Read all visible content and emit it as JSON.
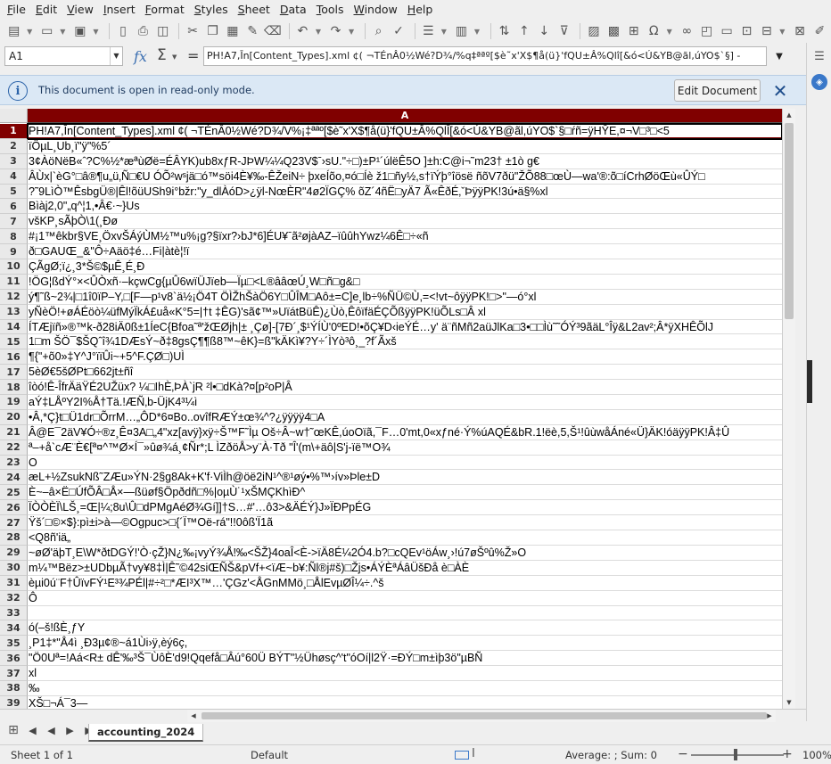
{
  "menu": [
    "File",
    "Edit",
    "View",
    "Insert",
    "Format",
    "Styles",
    "Sheet",
    "Data",
    "Tools",
    "Window",
    "Help"
  ],
  "formula": {
    "name_box": "A1",
    "content": "PH!A7,Īn[Content_Types].xml ¢( ¬TÉnÂ0½Wé?D¾/%q‡ªªº[$è˜x'X$¶å(ü}'fQU±Â%Qlî[&ó<Ú&YB@ãl,úYO$`§] -"
  },
  "infobar": {
    "message": "This document is open in read-only mode.",
    "edit_button": "Edit Document"
  },
  "grid": {
    "column_header": "A",
    "rows": [
      {
        "n": "1",
        "text": "PH!A7,Īn[Content_Types].xml ¢( ¬TÉnÂ0½Wé?D¾/V%¡‡ªªº[$è˜x'X$¶å(ü}'fQU±Â%QlÎ[&ó<Ú&YB@ãl,úYO$`§□ŕñ=ÿHŶE,¤¬V□³□<5"
      },
      {
        "n": "2",
        "text": "ïÖµL¸Ub¸ï\"ÿ\"%5´"
      },
      {
        "n": "3",
        "text": "3¢ÀöNëB«ˆ?C%½*æªùØë=ÉÂYK)ub8xƒR-JÞW¼¼Q23V$ˉ›sU.\"÷□)±P¹´úlëÊ5O ]±h:C@i¬˜m23†      ±1ò g€"
      },
      {
        "n": "4",
        "text": "ÂÙx|`èG°□â®¶u„ü‚Ñ□€U ÓÕ²wˢjä□ó™söi4È¥‰-ÊŽeiN÷   þxeÍõo,¤ó□Íè ž1□ñy½,s†ïÝþ°îösë      ñõV7ðü\"ŽÕ88□œÙ—wa'®:õ□íCrhØöŒù«ÛÝ□"
      },
      {
        "n": "5",
        "text": "?˜9LìÒ™ÊsbgÜ®|Êl!õüUSh9i°bžr:\"y_dlÀóD>¿ÿl-NœÈR\"4ø2ÏGÇ% õZ´4ñË□yÄ7  Ã«ÊðÉ‚ˇÞÿÿPK!3ú•ä§%xl"
      },
      {
        "n": "6",
        "text": "Bìàj2,0\"„q^¦1,•Â€·~}Us"
      },
      {
        "n": "7",
        "text": "všKP¸sÃþÒ\\1(¸Ðø"
      },
      {
        "n": "8",
        "text": "#¡1™êkbr§VE¸ÖxvŠÁýÙM½™u%¡g?§ïxr?›bJ*6]ÉU¥ˉã²øjàAZ–ïûûhYwz¼6Ê□÷«ñ"
      },
      {
        "n": "9",
        "text": "ð□GAUŒ_&\"Ô÷Aäö‡é…Fi|àtè¦!ï"
      },
      {
        "n": "10",
        "text": "ÇÃgØ;ï¿¸3*Š©$µÊ¸É¸Ð"
      },
      {
        "n": "11",
        "text": "!ÖG¦ßdÝ°×<ÛÒxñ·–kçwCg{µÛ6wïÜJïeb—Ïµ□<L®ââœÚ¸W□ñ□g&□"
      },
      {
        "n": "12",
        "text": "ý¶˜ß~2¾|□1î0ïP–Y,□[F—p¹v8`ä½¡Ö4T ÖÌŽhŠàÖ6Y□ÛÎM□Aô±=C]e¸lb÷%ÑÜ©Ù,=<!vt~ôÿÿPK!□>\"—ó°xl"
      },
      {
        "n": "13",
        "text": "yÑèÖ!+øÁÉöò¼üfMýÏkÁ£uå«K°5=|†t ‡ÊG)'sã¢™»UïátBüÊ)¿Ùò,ÊôïfäÉÇÕßÿÿPK!üÕLs□Â      xl"
      },
      {
        "n": "14",
        "text": "ÍTÆjïñ»®™k-ð28iÄ0ß±1ÍeC{Bfoa˜ª'žŒØjh|± ¸Çø]-[7Ð´¸$¹ÝÍÙ'0ºED!•õÇ¥D‹ieÝÉ…y'  ä¨ñMñ2aüJlKa□3•□□Ìù˜˜ÓÝ³9ãäL°Îÿ&L2av²;Â*ÿXHÊÕlJ"
      },
      {
        "n": "15",
        "text": "1□m ŠÖ¯$ŠQˆî¾1DÆsÝ~ð‡8gsÇ¶¶ß8™~êK}=ß\"kÄKì¥?Y÷´ÌYò³ô¸_?f´Ãxš"
      },
      {
        "n": "16",
        "text": "¶{\"+õ0»‡Y^J°ïïÛi~+5^F.ÇØ□)UÌ"
      },
      {
        "n": "17",
        "text": "5èØ€5šØPt□662jt±ñî"
      },
      {
        "n": "18",
        "text": "îòó!Ê-ÎfrÄäŸÉ2UŽüx? ¼□IhÈ‚ÞÀ`jR   ²l•□dKà?¤[p²oP|Â"
      },
      {
        "n": "19",
        "text": "aÝ‡LÅºY2I%Å†Tä.!ÆÑ‚b-ÜjK4³¼ì"
      },
      {
        "n": "20",
        "text": "•Â,*Ç}t□Ü1dr□ÕrrM…„ÔD*6¤Bo..ovîfRÆÝ±œ¾^?¿ÿÿÿÿ4□A"
      },
      {
        "n": "21",
        "text": "Â@E¯2äV¥Ó÷®z¸Ê¤3A□„4\"xz[avÿ}xÿ÷Š™F˜Ìµ      Oš÷Â~w†˜œKÊ,úoOïã,¯F…0'mt,0«xƒné·Ý%úAQÉ&bR.1!ëè,5,Š¹!ûùwåÁné«Ü}ÄK!óäÿÿPK!Â‡Û"
      },
      {
        "n": "22",
        "text": "ª–+å`cÆ¨È€[ª¤^™Ø×Í¯»ûø¾á¸¢Ñr*;L ÌZðöÅ>y¨À·Tð \"Î'(m\\+äô|S'j-ïë™O¾"
      },
      {
        "n": "23",
        "text": "O"
      },
      {
        "n": "24",
        "text": "æL+½ZsukNß˜ZÆu»ÝN·2§g8Ak+K'f·ViÌh@öë2iN¹^®¹øý•%™›ív»Þle±D"
      },
      {
        "n": "25",
        "text": "È~–â×Ë□ÚfÕÂ□Å×—ßüøf§Öpðdñ□%|oµÙ˙¹xŠMÇKhìÐ^"
      },
      {
        "n": "26",
        "text": "ÏÒÒÈÏ\\LŠ¸=Œ|¼;8u\\Û□dPMgAéØ¾Gí]]†S…#'…ô3>&ÄÉÝ}J»ÏÐPpÉG"
      },
      {
        "n": "27",
        "text": "Ÿš´□©×$}:pì±i>à—©Ogpuc>□{´Ï™Oë-rá\"!!0ôß'Ï1ã"
      },
      {
        "n": "28",
        "text": "<Q8ñ'iä„"
      },
      {
        "n": "29",
        "text": "~øØ'äþT¸E\\W*ðtDGÝ!'Ò·çŽ}N¿‰¡vyÝ¾Å!‰<ŠŽ}4oaÎ<È->ïÄ8É¼2Ó4.b?□cQEv¹öÁw¸›!ú7øŠºû%Ž»O"
      },
      {
        "n": "30",
        "text": "m¼™Bëz>±UDbµÃ†vy¥8‡Ì|Ê˜©42siŒÑŠ&pVf+<ïÆ~b¥:Ñl®j#š)□Žjs•ÁÝÈªÁâÜšÐå è□ÀÈ"
      },
      {
        "n": "31",
        "text": "èµi0ú¨F†ÛïvFÝ¹E³¾PÉl|#÷²□*ÆI³X™…'ÇGz'<ÅGnMMö¸□ÅlEvµØÎ¼÷.^š"
      },
      {
        "n": "32",
        "text": "Ô"
      },
      {
        "n": "33",
        "text": ""
      },
      {
        "n": "34",
        "text": "ó(–š!ßÈ¸ƒY"
      },
      {
        "n": "35",
        "text": "¸P1‡*\"Å4ì       ¸Ð3µ¢®~á1Ùi›ÿ,èý6ç,"
      },
      {
        "n": "36",
        "text": "\"Ö0Uª=!Aá<R± dÊ'‰³Š¯ÙôÈ'd9!Qqefå□Âú°60Ü BÝT\"½Ühøsç^'t\"óOí|l2Ÿ·=ÐÝ□m±ìþ3ö\"µBÑ"
      },
      {
        "n": "37",
        "text": "xl"
      },
      {
        "n": "38",
        "text": "‰"
      },
      {
        "n": "39",
        "text": "XŠ□¬Á¯3—"
      }
    ]
  },
  "sheet_tab": "accounting_2024",
  "status": {
    "sheet": "Sheet 1 of 1",
    "page_style": "Default",
    "sum": "Average: ; Sum: 0",
    "zoom": "100%"
  }
}
